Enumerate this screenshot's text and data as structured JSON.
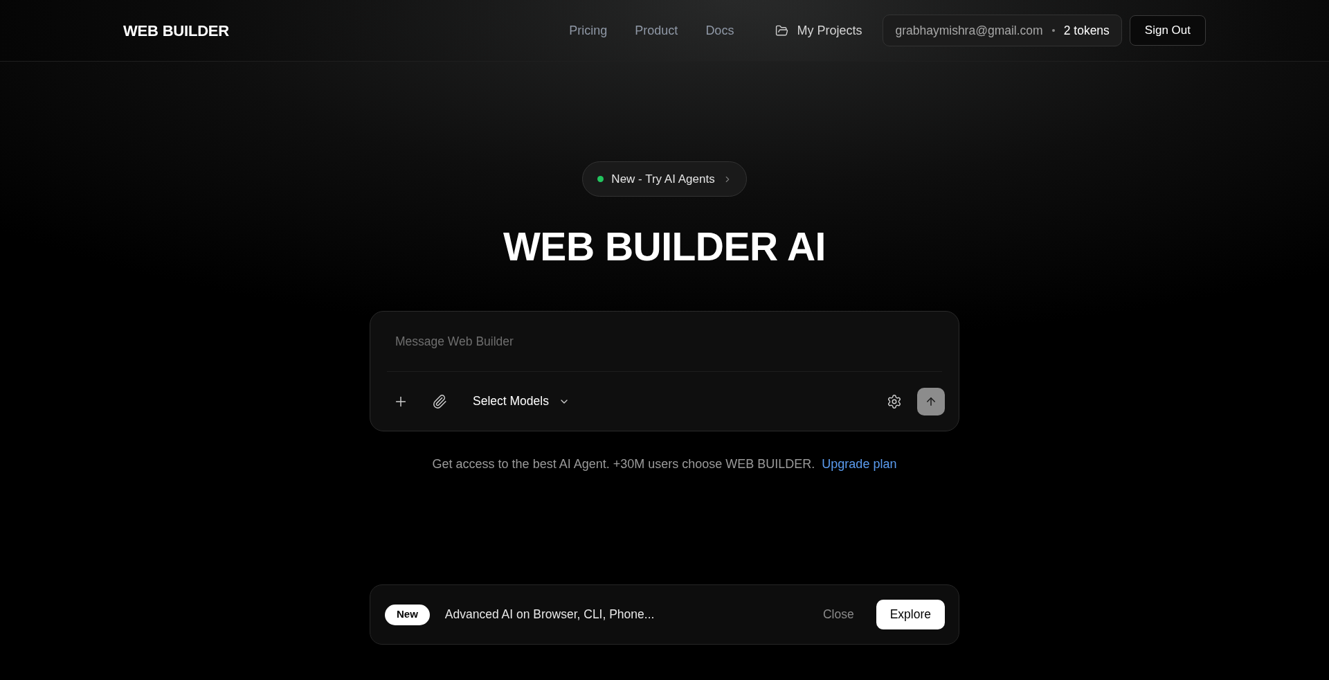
{
  "header": {
    "logo": "WEB BUILDER",
    "nav_links": [
      "Pricing",
      "Product",
      "Docs"
    ],
    "projects_link": "My Projects",
    "account": {
      "email": "grabhaymishra@gmail.com",
      "tokens": "2 tokens"
    },
    "sign_out": "Sign Out"
  },
  "announcement": {
    "label": "New - Try AI Agents"
  },
  "title": "WEB BUILDER AI",
  "composer": {
    "placeholder": "Message Web Builder",
    "model_select": "Select Models"
  },
  "promo": {
    "text": "Get access to the best AI Agent. +30M users choose WEB BUILDER.",
    "link": "Upgrade plan"
  },
  "banner": {
    "badge": "New",
    "text": "Advanced AI on Browser, CLI, Phone...",
    "close": "Close",
    "action": "Explore"
  }
}
